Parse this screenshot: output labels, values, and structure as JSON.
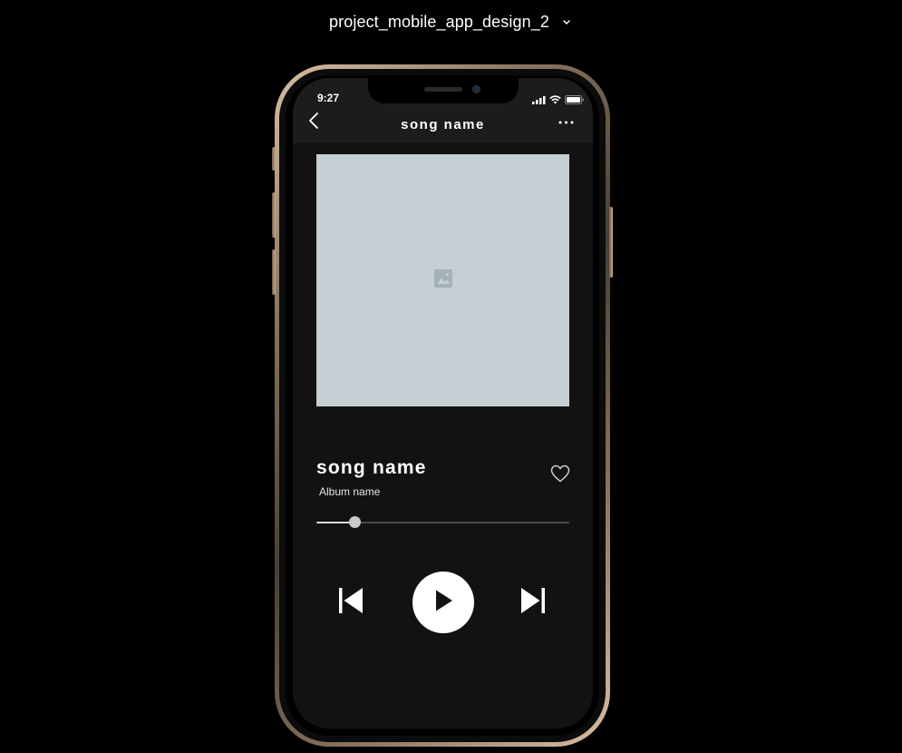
{
  "project": {
    "title": "project_mobile_app_design_2",
    "caret_icon": "chevron-down-icon"
  },
  "status_bar": {
    "time": "9:27",
    "icons": [
      "signal-icon",
      "wifi-icon",
      "battery-icon"
    ]
  },
  "app_bar": {
    "title": "song name",
    "back_icon": "chevron-left-icon",
    "more_icon": "more-horizontal-icon"
  },
  "artwork": {
    "placeholder_icon": "image-icon",
    "background_color": "#c5cfd4"
  },
  "track": {
    "title": "song name",
    "album": "Album name",
    "favorite_icon": "heart-icon",
    "progress": 0.15
  },
  "controls": {
    "previous_icon": "skip-previous-icon",
    "play_icon": "play-icon",
    "next_icon": "skip-next-icon"
  },
  "colors": {
    "background": "#000000",
    "screen": "#121212",
    "app_bar": "#1c1c1c",
    "accent": "#ffffff"
  }
}
